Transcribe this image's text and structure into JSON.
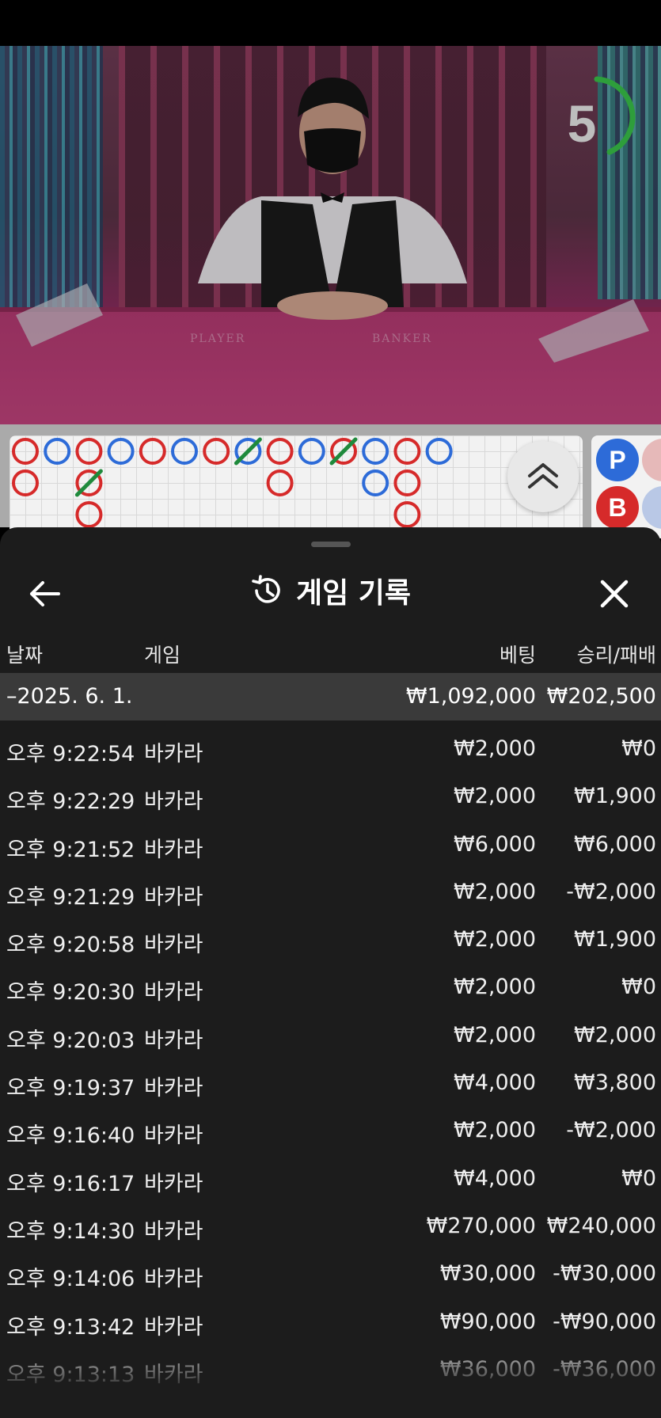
{
  "timer": {
    "value": "5",
    "progress": 0.4,
    "color": "#2e9e3b"
  },
  "side_panel": {
    "player_label": "P",
    "banker_label": "B"
  },
  "bead_road": {
    "cells": [
      {
        "col": 0,
        "row": 0,
        "c": "red"
      },
      {
        "col": 1,
        "row": 0,
        "c": "blue"
      },
      {
        "col": 2,
        "row": 0,
        "c": "red"
      },
      {
        "col": 3,
        "row": 0,
        "c": "blue"
      },
      {
        "col": 4,
        "row": 0,
        "c": "red"
      },
      {
        "col": 5,
        "row": 0,
        "c": "blue"
      },
      {
        "col": 6,
        "row": 0,
        "c": "red"
      },
      {
        "col": 7,
        "row": 0,
        "c": "blue",
        "tie": true
      },
      {
        "col": 8,
        "row": 0,
        "c": "red"
      },
      {
        "col": 9,
        "row": 0,
        "c": "blue"
      },
      {
        "col": 10,
        "row": 0,
        "c": "red",
        "tie": true
      },
      {
        "col": 11,
        "row": 0,
        "c": "blue"
      },
      {
        "col": 12,
        "row": 0,
        "c": "red"
      },
      {
        "col": 13,
        "row": 0,
        "c": "blue"
      },
      {
        "col": 0,
        "row": 1,
        "c": "red"
      },
      {
        "col": 2,
        "row": 1,
        "c": "red",
        "tie": true
      },
      {
        "col": 8,
        "row": 1,
        "c": "red"
      },
      {
        "col": 11,
        "row": 1,
        "c": "blue"
      },
      {
        "col": 12,
        "row": 1,
        "c": "red"
      },
      {
        "col": 2,
        "row": 2,
        "c": "red"
      },
      {
        "col": 12,
        "row": 2,
        "c": "red"
      }
    ]
  },
  "sheet": {
    "title": "게임 기록",
    "columns": {
      "date": "날짜",
      "game": "게임",
      "bet": "베팅",
      "win_loss": "승리/패배"
    },
    "group": {
      "date": "–2025. 6. 1.",
      "bet": "₩1,092,000",
      "win_loss": "₩202,500"
    },
    "rows": [
      {
        "time": "오후 9:22:54",
        "game": "바카라",
        "bet": "₩2,000",
        "win_loss": "₩0"
      },
      {
        "time": "오후 9:22:29",
        "game": "바카라",
        "bet": "₩2,000",
        "win_loss": "₩1,900"
      },
      {
        "time": "오후 9:21:52",
        "game": "바카라",
        "bet": "₩6,000",
        "win_loss": "₩6,000"
      },
      {
        "time": "오후 9:21:29",
        "game": "바카라",
        "bet": "₩2,000",
        "win_loss": "-₩2,000"
      },
      {
        "time": "오후 9:20:58",
        "game": "바카라",
        "bet": "₩2,000",
        "win_loss": "₩1,900"
      },
      {
        "time": "오후 9:20:30",
        "game": "바카라",
        "bet": "₩2,000",
        "win_loss": "₩0"
      },
      {
        "time": "오후 9:20:03",
        "game": "바카라",
        "bet": "₩2,000",
        "win_loss": "₩2,000"
      },
      {
        "time": "오후 9:19:37",
        "game": "바카라",
        "bet": "₩4,000",
        "win_loss": "₩3,800"
      },
      {
        "time": "오후 9:16:40",
        "game": "바카라",
        "bet": "₩2,000",
        "win_loss": "-₩2,000"
      },
      {
        "time": "오후 9:16:17",
        "game": "바카라",
        "bet": "₩4,000",
        "win_loss": "₩0"
      },
      {
        "time": "오후 9:14:30",
        "game": "바카라",
        "bet": "₩270,000",
        "win_loss": "₩240,000"
      },
      {
        "time": "오후 9:14:06",
        "game": "바카라",
        "bet": "₩30,000",
        "win_loss": "-₩30,000"
      },
      {
        "time": "오후 9:13:42",
        "game": "바카라",
        "bet": "₩90,000",
        "win_loss": "-₩90,000"
      },
      {
        "time": "오후 9:13:13",
        "game": "바카라",
        "bet": "₩36,000",
        "win_loss": "-₩36,000"
      }
    ]
  },
  "colors": {
    "sheet_bg": "#1c1c1c",
    "group_bg": "#3a3a3a",
    "player": "#2d6bd8",
    "banker": "#d62a2a",
    "tie": "#1f8a3c"
  },
  "icons": {
    "back": "arrow-left-icon",
    "history": "history-icon",
    "close": "close-icon",
    "collapse": "double-chevron-up-icon"
  }
}
